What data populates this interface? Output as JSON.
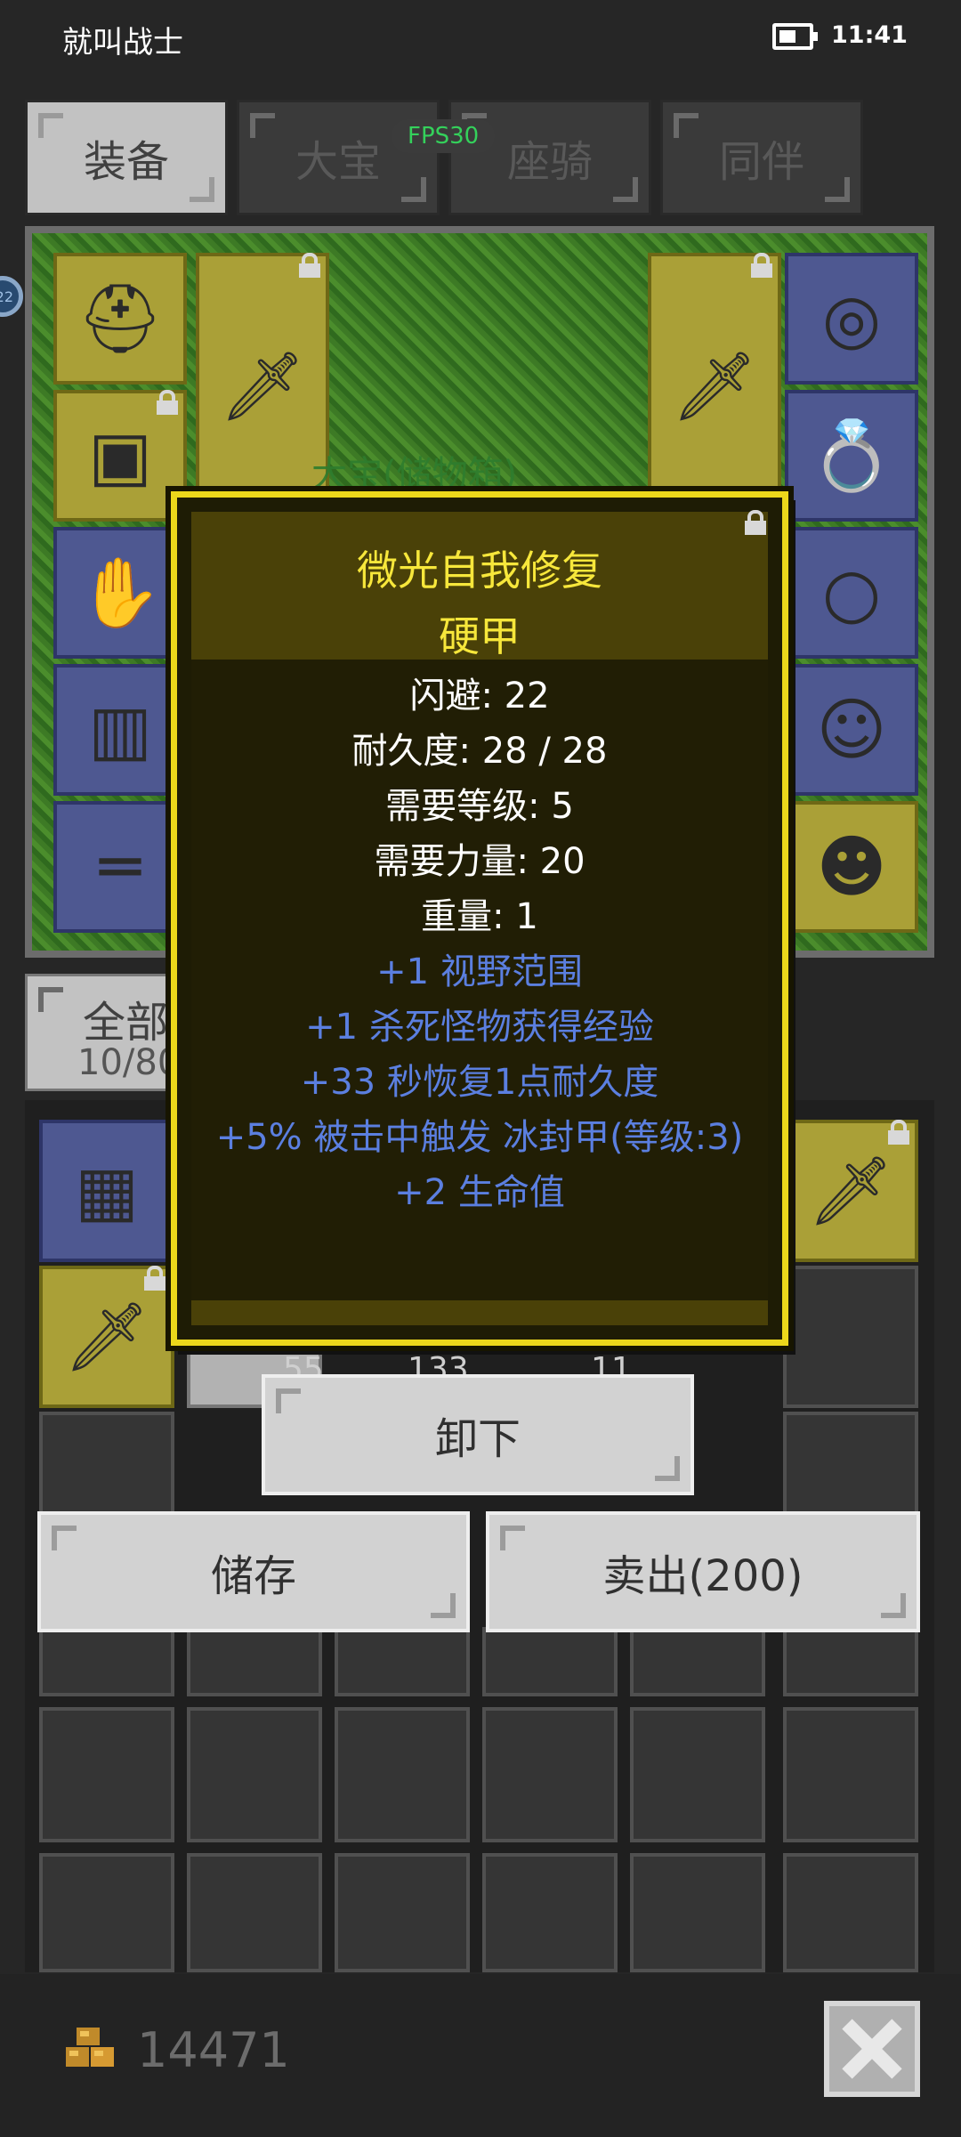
{
  "status_bar": {
    "app_title": "就叫战士",
    "time": "11:41",
    "battery_level": 0.55
  },
  "tabs": [
    {
      "label": "装备",
      "active": true
    },
    {
      "label": "大宝",
      "active": false
    },
    {
      "label": "座骑",
      "active": false
    },
    {
      "label": "同伴",
      "active": false
    }
  ],
  "fps": "FPS30",
  "storage_label": "大宝(储物箱)",
  "side_badge": "22",
  "inventory": {
    "filter_label": "全部",
    "capacity": "10/80",
    "counts": [
      "55",
      "133",
      "11"
    ]
  },
  "tooltip": {
    "name": "微光自我修复",
    "type": "硬甲",
    "stats": [
      "闪避: 22",
      "耐久度: 28 / 28",
      "需要等级: 5",
      "需要力量: 20",
      "重量: 1"
    ],
    "affixes": [
      "+1 视野范围",
      "+1 杀死怪物获得经验",
      "+33 秒恢复1点耐久度",
      "+5% 被击中触发 冰封甲(等级:3)",
      "+2 生命值"
    ]
  },
  "actions": {
    "unequip": "卸下",
    "store": "储存",
    "sell": "卖出(200)"
  },
  "gold": "14471",
  "colors": {
    "tooltip_border": "#ecd71b",
    "affix_text": "#5b7fe0",
    "fps_text": "#34d15b"
  }
}
